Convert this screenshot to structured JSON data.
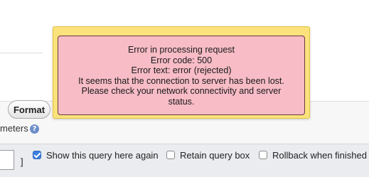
{
  "query_panel": {
    "format_button_label": "Format",
    "parameters_text": "meters",
    "help_icon": "help-icon",
    "delimiter_close": "]"
  },
  "options": {
    "show_query": {
      "label": "Show this query here again",
      "checked": true
    },
    "retain_box": {
      "label": "Retain query box",
      "checked": false
    },
    "rollback": {
      "label": "Rollback when finished",
      "checked": false
    }
  },
  "error": {
    "lines": [
      "Error in processing request",
      "Error code: 500",
      "Error text: error (rejected)",
      "It seems that the connection to server has been lost.",
      "Please check your network connectivity and server",
      "status."
    ],
    "colors": {
      "dialog_bg": "#fbe27c",
      "message_bg": "#f7bcc6"
    }
  },
  "colors": {
    "checkbox_checked": "#3b7de0",
    "help_icon": "#6e8ec9"
  }
}
